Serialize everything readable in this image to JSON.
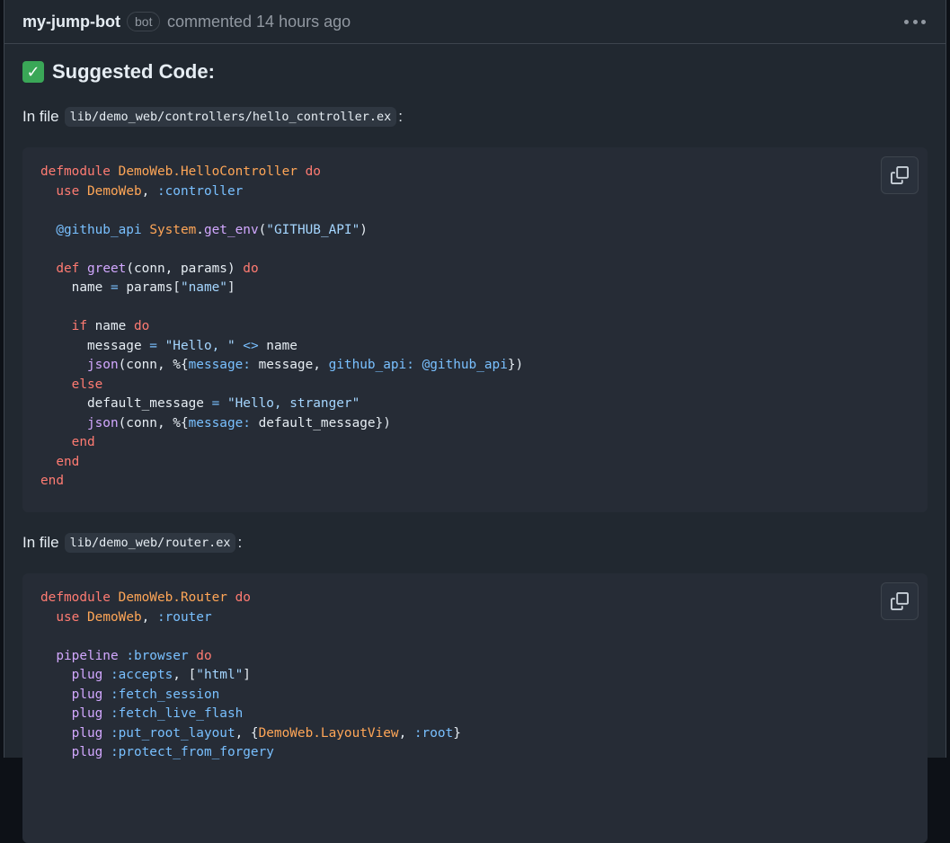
{
  "comment": {
    "author": "my-jump-bot",
    "badge": "bot",
    "meta": "commented 14 hours ago",
    "heading_icon": "check-mark-icon",
    "heading": "Suggested Code:"
  },
  "files": [
    {
      "prefix": "In file",
      "path": "lib/demo_web/controllers/hello_controller.ex",
      "suffix": ":",
      "lines": [
        [
          [
            "kw",
            "defmodule"
          ],
          [
            "t",
            " "
          ],
          [
            "mod",
            "DemoWeb.HelloController"
          ],
          [
            "t",
            " "
          ],
          [
            "kw",
            "do"
          ]
        ],
        [
          [
            "t",
            "  "
          ],
          [
            "kw",
            "use"
          ],
          [
            "t",
            " "
          ],
          [
            "mod",
            "DemoWeb"
          ],
          [
            "t",
            ", "
          ],
          [
            "atom",
            ":controller"
          ]
        ],
        [],
        [
          [
            "t",
            "  "
          ],
          [
            "attr",
            "@github_api"
          ],
          [
            "t",
            " "
          ],
          [
            "mod",
            "System"
          ],
          [
            "t",
            "."
          ],
          [
            "fn",
            "get_env"
          ],
          [
            "t",
            "("
          ],
          [
            "str",
            "\"GITHUB_API\""
          ],
          [
            "t",
            ")"
          ]
        ],
        [],
        [
          [
            "t",
            "  "
          ],
          [
            "kw",
            "def"
          ],
          [
            "t",
            " "
          ],
          [
            "fn",
            "greet"
          ],
          [
            "t",
            "(conn, params) "
          ],
          [
            "kw",
            "do"
          ]
        ],
        [
          [
            "t",
            "    name "
          ],
          [
            "op",
            "="
          ],
          [
            "t",
            " params["
          ],
          [
            "str",
            "\"name\""
          ],
          [
            "t",
            "]"
          ]
        ],
        [],
        [
          [
            "t",
            "    "
          ],
          [
            "kw",
            "if"
          ],
          [
            "t",
            " name "
          ],
          [
            "kw",
            "do"
          ]
        ],
        [
          [
            "t",
            "      message "
          ],
          [
            "op",
            "="
          ],
          [
            "t",
            " "
          ],
          [
            "str",
            "\"Hello, \""
          ],
          [
            "t",
            " "
          ],
          [
            "op",
            "<>"
          ],
          [
            "t",
            " name"
          ]
        ],
        [
          [
            "t",
            "      "
          ],
          [
            "fn",
            "json"
          ],
          [
            "t",
            "(conn, %{"
          ],
          [
            "atom",
            "message:"
          ],
          [
            "t",
            " message, "
          ],
          [
            "atom",
            "github_api:"
          ],
          [
            "t",
            " "
          ],
          [
            "attr",
            "@github_api"
          ],
          [
            "t",
            "})"
          ]
        ],
        [
          [
            "t",
            "    "
          ],
          [
            "kw",
            "else"
          ]
        ],
        [
          [
            "t",
            "      default_message "
          ],
          [
            "op",
            "="
          ],
          [
            "t",
            " "
          ],
          [
            "str",
            "\"Hello, stranger\""
          ]
        ],
        [
          [
            "t",
            "      "
          ],
          [
            "fn",
            "json"
          ],
          [
            "t",
            "(conn, %{"
          ],
          [
            "atom",
            "message:"
          ],
          [
            "t",
            " default_message})"
          ]
        ],
        [
          [
            "t",
            "    "
          ],
          [
            "kw",
            "end"
          ]
        ],
        [
          [
            "t",
            "  "
          ],
          [
            "kw",
            "end"
          ]
        ],
        [
          [
            "kw",
            "end"
          ]
        ]
      ]
    },
    {
      "prefix": "In file",
      "path": "lib/demo_web/router.ex",
      "suffix": ":",
      "lines": [
        [
          [
            "kw",
            "defmodule"
          ],
          [
            "t",
            " "
          ],
          [
            "mod",
            "DemoWeb.Router"
          ],
          [
            "t",
            " "
          ],
          [
            "kw",
            "do"
          ]
        ],
        [
          [
            "t",
            "  "
          ],
          [
            "kw",
            "use"
          ],
          [
            "t",
            " "
          ],
          [
            "mod",
            "DemoWeb"
          ],
          [
            "t",
            ", "
          ],
          [
            "atom",
            ":router"
          ]
        ],
        [],
        [
          [
            "t",
            "  "
          ],
          [
            "fn",
            "pipeline"
          ],
          [
            "t",
            " "
          ],
          [
            "atom",
            ":browser"
          ],
          [
            "t",
            " "
          ],
          [
            "kw",
            "do"
          ]
        ],
        [
          [
            "t",
            "    "
          ],
          [
            "fn",
            "plug"
          ],
          [
            "t",
            " "
          ],
          [
            "atom",
            ":accepts"
          ],
          [
            "t",
            ", ["
          ],
          [
            "str",
            "\"html\""
          ],
          [
            "t",
            "]"
          ]
        ],
        [
          [
            "t",
            "    "
          ],
          [
            "fn",
            "plug"
          ],
          [
            "t",
            " "
          ],
          [
            "atom",
            ":fetch_session"
          ]
        ],
        [
          [
            "t",
            "    "
          ],
          [
            "fn",
            "plug"
          ],
          [
            "t",
            " "
          ],
          [
            "atom",
            ":fetch_live_flash"
          ]
        ],
        [
          [
            "t",
            "    "
          ],
          [
            "fn",
            "plug"
          ],
          [
            "t",
            " "
          ],
          [
            "atom",
            ":put_root_layout"
          ],
          [
            "t",
            ", {"
          ],
          [
            "mod",
            "DemoWeb.LayoutView"
          ],
          [
            "t",
            ", "
          ],
          [
            "atom",
            ":root"
          ],
          [
            "t",
            "}"
          ]
        ],
        [
          [
            "t",
            "    "
          ],
          [
            "fn",
            "plug"
          ],
          [
            "t",
            " "
          ],
          [
            "atom",
            ":protect_from_forgery"
          ]
        ]
      ]
    }
  ],
  "icons": {
    "copy": "copy-icon",
    "more": "kebab-menu-icon"
  }
}
